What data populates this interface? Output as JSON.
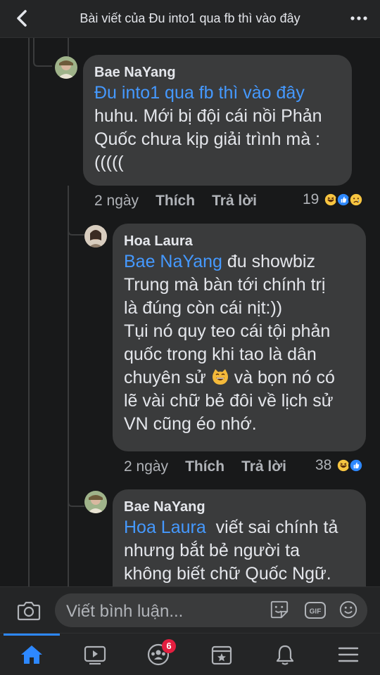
{
  "header": {
    "title": "Bài viết của Đu into1 qua fb thì vào đây"
  },
  "comments": [
    {
      "author": "Bae NaYang",
      "mention": "Đu into1 qua fb thì vào đây",
      "lines": [
        "huhu. Mới bị đội cái nồi Phản",
        "Quốc chưa kịp giải trình mà :",
        "((((("
      ],
      "time": "2 ngày",
      "like_label": "Thích",
      "reply_label": "Trả lời",
      "reaction_count": "19"
    },
    {
      "author": "Hoa Laura",
      "mention": "Bae NaYang",
      "first_line_rest": " đu showbiz",
      "lines_a": [
        "Trung mà bàn tới chính trị",
        "là đúng còn cái nịt:))",
        "Tụi nó quy teo cái tội phản",
        "quốc trong khi tao là dân"
      ],
      "line_with_emoji_before": "chuyên sử ",
      "line_with_emoji_after": " và bọn nó có",
      "lines_b": [
        "lẽ vài chữ bẻ đôi về lịch sử",
        "VN cũng éo nhớ."
      ],
      "time": "2 ngày",
      "like_label": "Thích",
      "reply_label": "Trả lời",
      "reaction_count": "38"
    },
    {
      "author": "Bae NaYang",
      "mention": "Hoa Laura",
      "first_line_rest": "  viết sai chính tả",
      "lines": [
        "nhưng bắt bẻ người ta",
        "không biết chữ Quốc Ngữ."
      ]
    }
  ],
  "composer": {
    "placeholder": "Viết bình luận..."
  },
  "tabbar": {
    "tabs": [
      "home-icon",
      "watch-icon",
      "groups-icon",
      "pages-icon",
      "notifications-icon",
      "menu-icon"
    ],
    "groups_badge": "6"
  },
  "colors": {
    "background": "#18191a",
    "bubble": "#3a3b3c",
    "mention": "#4599ff",
    "accent": "#2d88ff",
    "badge": "#e41e3f"
  }
}
